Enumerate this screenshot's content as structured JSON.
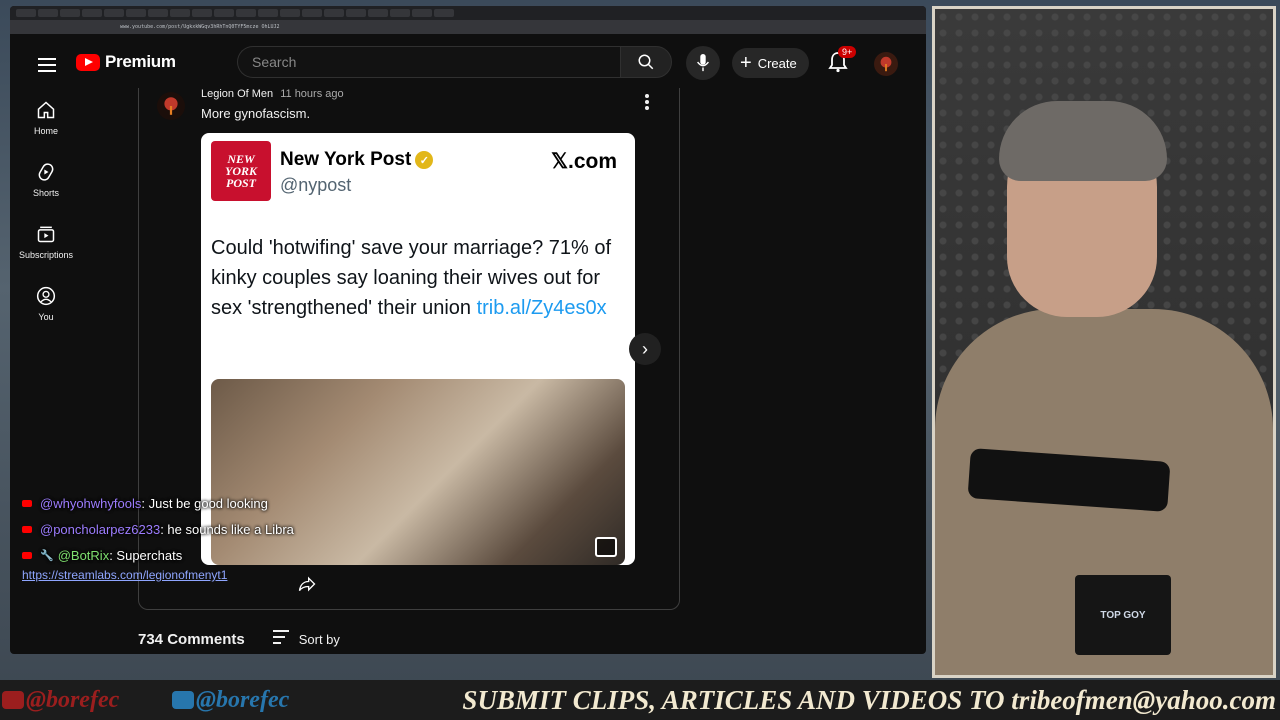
{
  "browser": {
    "url": "www.youtube.com/post/UgkxkWGqv3hRhTnQ0TYF5mcze OhLUJ2"
  },
  "header": {
    "logo_text": "Premium",
    "search_placeholder": "Search",
    "create_label": "Create",
    "notifications_badge": "9+"
  },
  "sidebar": {
    "items": [
      {
        "label": "Home",
        "icon": "home-icon"
      },
      {
        "label": "Shorts",
        "icon": "shorts-icon"
      },
      {
        "label": "Subscriptions",
        "icon": "subscriptions-icon"
      },
      {
        "label": "You",
        "icon": "you-icon"
      }
    ]
  },
  "post": {
    "author": "Legion Of Men",
    "time": "11 hours ago",
    "text": "More gynofascism."
  },
  "tweet": {
    "logo_text": "NEW YORK POST",
    "name": "New York Post",
    "handle": "@nypost",
    "source": "𝕏.com",
    "body": "Could 'hotwifing' save your marriage? 71% of kinky couples say loaning their wives out for sex 'strengthened' their union",
    "link": "trib.al/Zy4es0x"
  },
  "comments": {
    "count_label": "734 Comments",
    "sort_label": "Sort by"
  },
  "chat": {
    "lines": [
      {
        "user": "@whyohwhyfools",
        "message": ": Just be good looking"
      },
      {
        "user": "@poncholarpez6233",
        "message": ": he sounds like a Libra"
      },
      {
        "user": "@BotRix",
        "message": ": Superchats"
      }
    ],
    "link": "https://streamlabs.com/legionofmenyt1"
  },
  "webcam": {
    "mug_text": "TOP GOY"
  },
  "banner": {
    "handle1": "@borefec",
    "handle2": "@borefec",
    "text": "SUBMIT CLIPS, ARTICLES AND VIDEOS TO tribeofmen@yahoo.com"
  },
  "colors": {
    "youtube_red": "#ff0000",
    "chat_user": "#9d7dff",
    "bot_user": "#7fe06f",
    "link_blue": "#1d9bf0"
  }
}
